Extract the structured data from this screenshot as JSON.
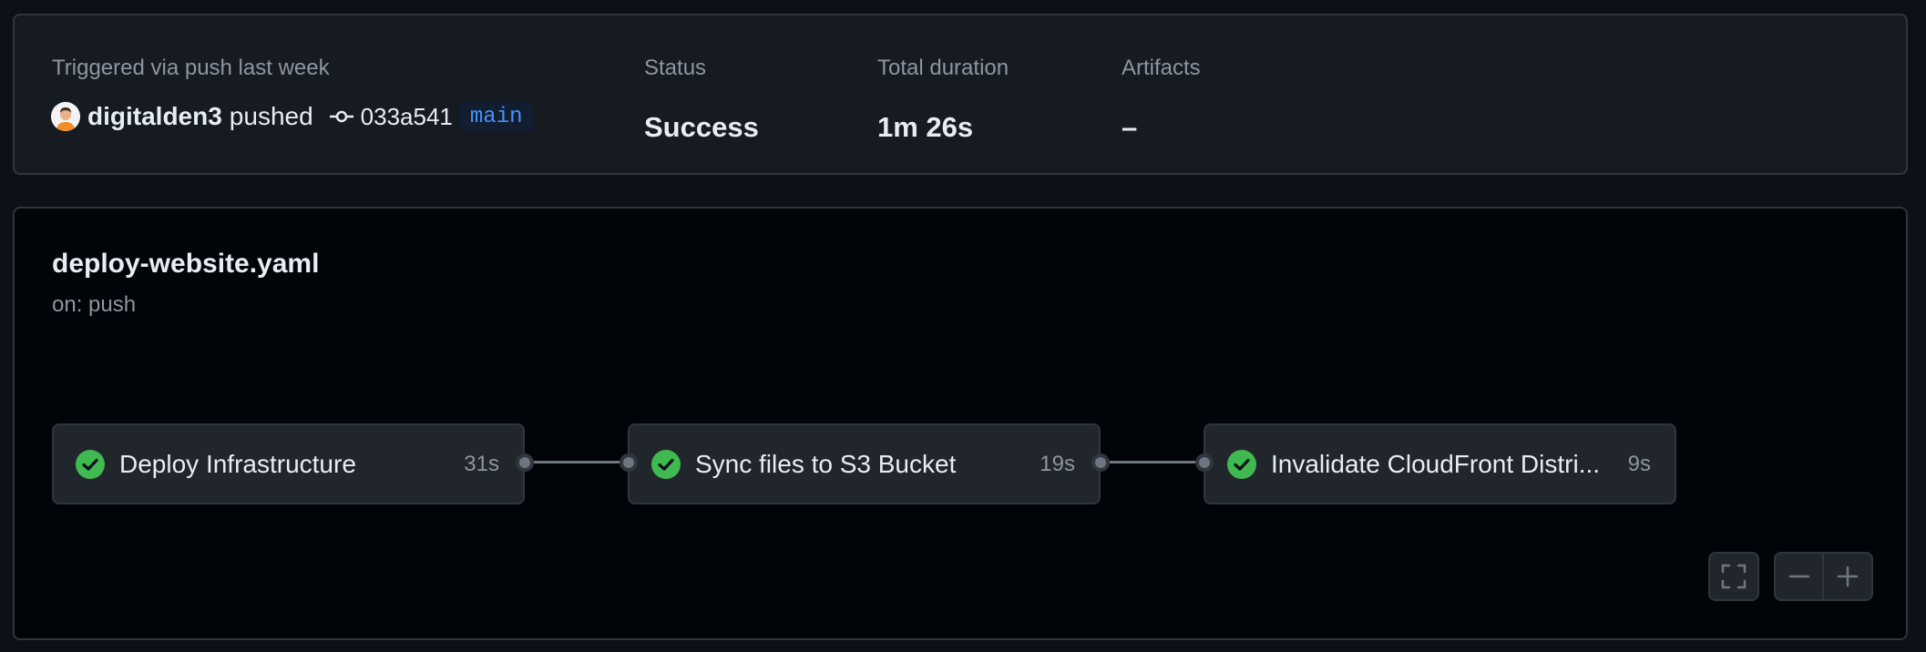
{
  "run": {
    "trigger_label": "Triggered via push last week",
    "actor": "digitalden3",
    "action": "pushed",
    "commit_sha": "033a541",
    "branch": "main"
  },
  "status": {
    "label": "Status",
    "value": "Success"
  },
  "duration": {
    "label": "Total duration",
    "value": "1m 26s"
  },
  "artifacts": {
    "label": "Artifacts",
    "value": "–"
  },
  "workflow": {
    "name": "deploy-website.yaml",
    "trigger": "on: push"
  },
  "jobs": [
    {
      "name": "Deploy Infrastructure",
      "duration": "31s",
      "status": "success"
    },
    {
      "name": "Sync files to S3 Bucket",
      "duration": "19s",
      "status": "success"
    },
    {
      "name": "Invalidate CloudFront Distri...",
      "duration": "9s",
      "status": "success"
    }
  ],
  "colors": {
    "success": "#3fb950",
    "branch": "#4493f8",
    "background": "#0d1117",
    "graph_background": "#010409"
  },
  "icons": {
    "commit": "git-commit-icon",
    "job_status": "check-circle-icon",
    "fullscreen": "fullscreen-icon",
    "zoom_out": "minus-icon",
    "zoom_in": "plus-icon"
  }
}
